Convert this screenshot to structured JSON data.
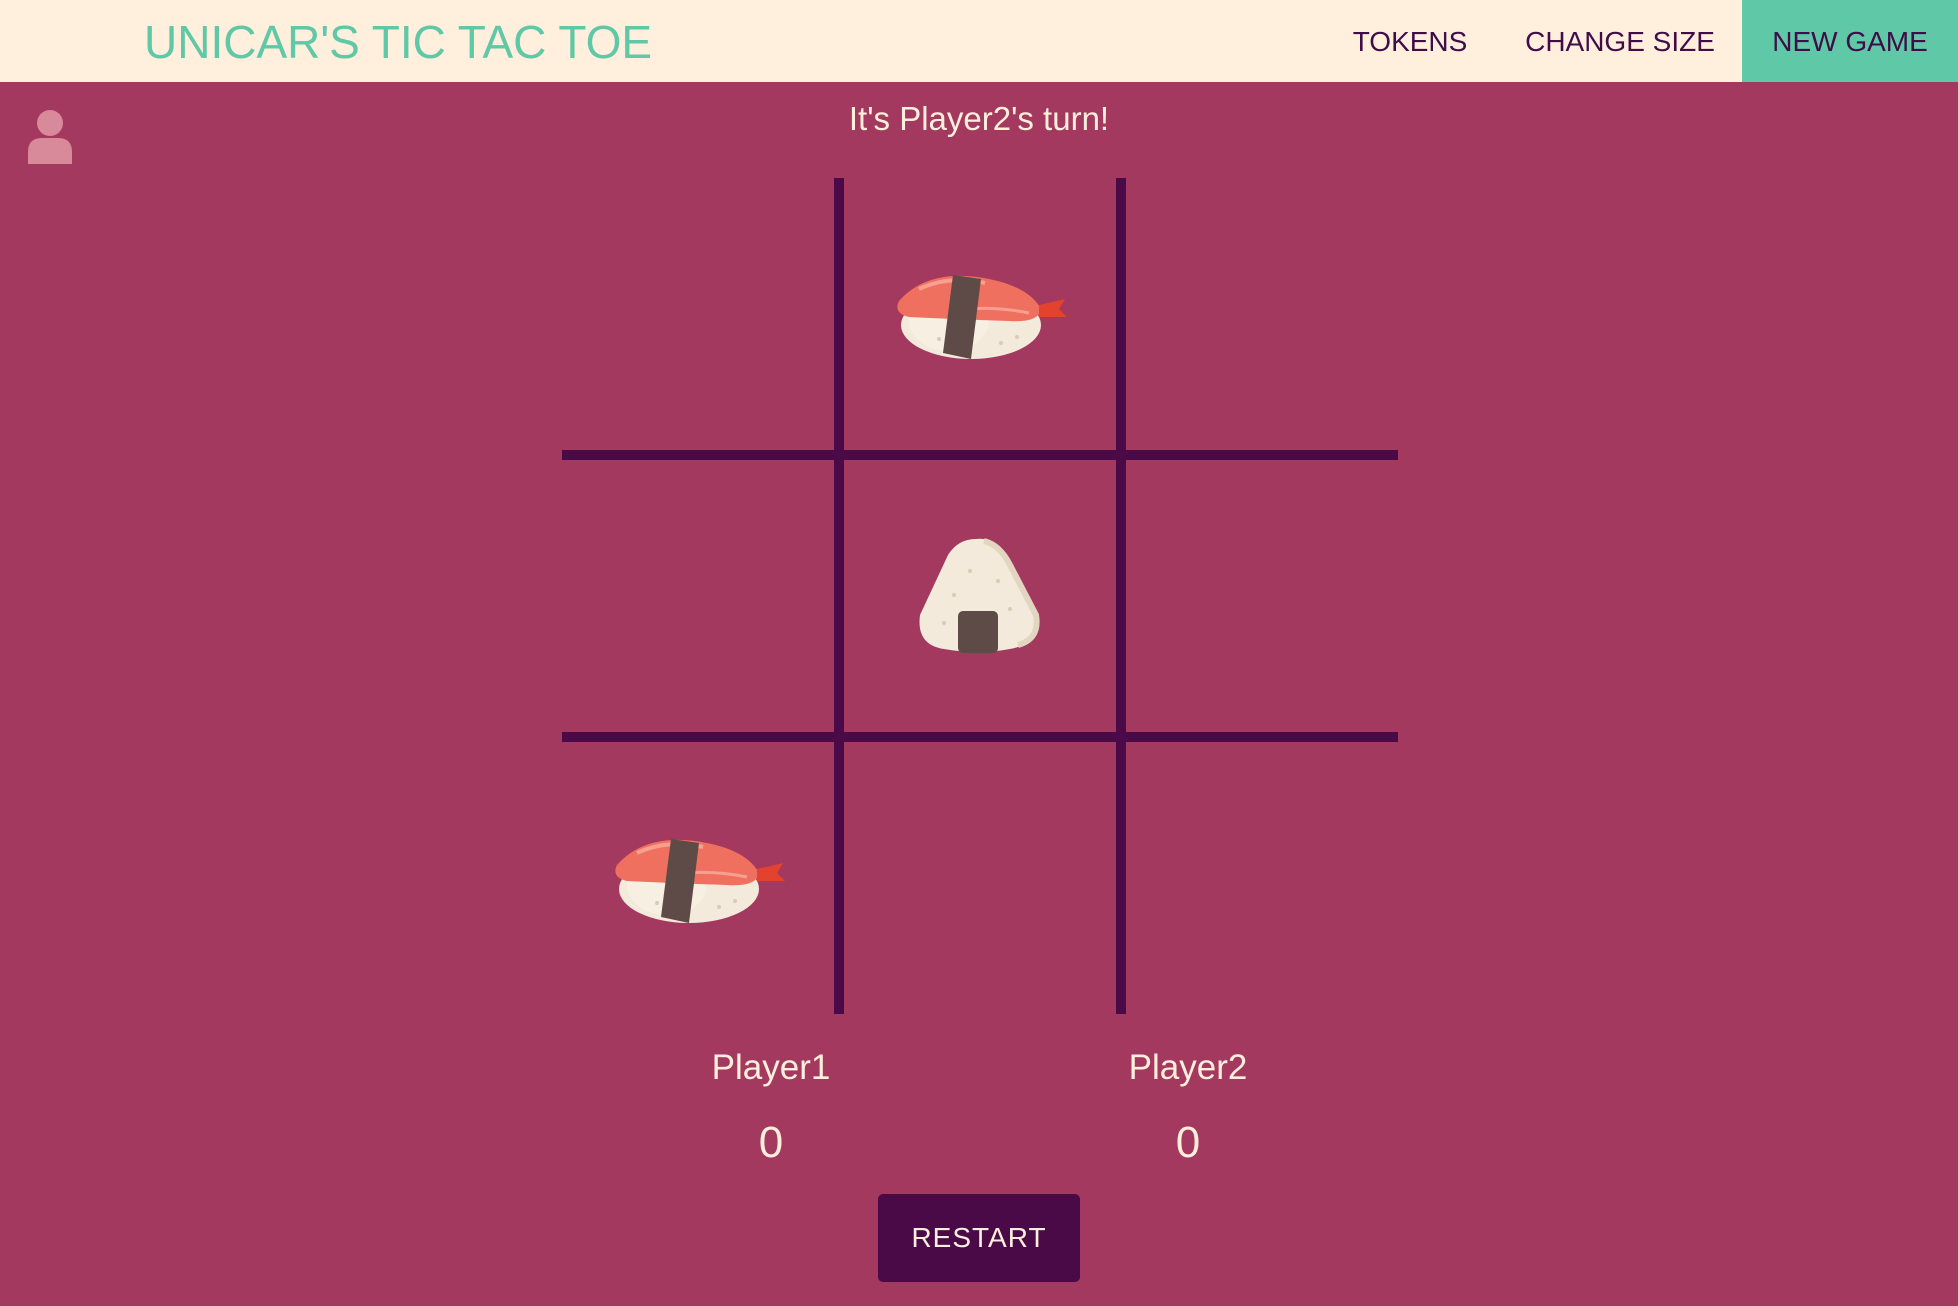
{
  "navbar": {
    "brand": "UNICAR'S TIC TAC TOE",
    "items": [
      {
        "label": "TOKENS"
      },
      {
        "label": "CHANGE SIZE"
      },
      {
        "label": "NEW GAME"
      }
    ]
  },
  "status_text": "It's Player2's turn!",
  "board": {
    "size": 3,
    "cells": [
      "",
      "nigiri",
      "",
      "",
      "onigiri",
      "",
      "nigiri",
      "",
      ""
    ]
  },
  "scoreboard": {
    "players": [
      {
        "name": "Player1",
        "score": "0"
      },
      {
        "name": "Player2",
        "score": "0"
      }
    ]
  },
  "restart_label": "RESTART",
  "colors": {
    "background": "#a4395f",
    "navbar": "#ffefdc",
    "brand": "#5fc8a6",
    "accent": "#5fc8a6",
    "grid": "#4a0a48",
    "text_light": "#ffefdc"
  },
  "icons": {
    "user": "user-icon",
    "token_player1": "nigiri-sushi-icon",
    "token_player2": "onigiri-icon"
  }
}
